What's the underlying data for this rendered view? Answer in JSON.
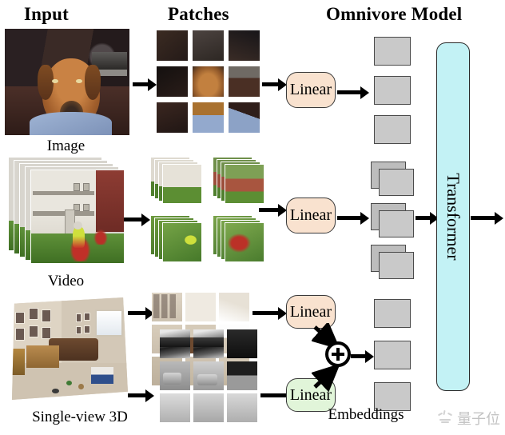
{
  "figure": {
    "title": "Omnivore Model architecture diagram",
    "headers": {
      "input": "Input",
      "patches": "Patches",
      "model": "Omnivore Model"
    },
    "row_labels": {
      "image": "Image",
      "video": "Video",
      "three_d": "Single-view 3D"
    },
    "embeddings_label": "Embeddings"
  },
  "blocks": {
    "linear_image": "Linear",
    "linear_video": "Linear",
    "linear_3d_rgb": "Linear",
    "linear_3d_depth": "Linear",
    "plus": "+",
    "transformer": "Transformer"
  },
  "colors": {
    "linear_rgb_fill": "#f9e2cf",
    "linear_depth_fill": "#e1f5d9",
    "transformer_fill": "#c3f2f5",
    "embedding_fill": "#c9c9c9",
    "embedding_border": "#4a4a4a",
    "arrow": "#000000",
    "background": "#ffffff",
    "watermark": "#c3c3c3"
  },
  "inputs": [
    {
      "id": "image",
      "label": "Image",
      "description": "Photo of a brown Rhodesian Ridgeback dog resting on a dark couch next to a person in blue jeans",
      "patch_grid": "3x3",
      "patch_type": "2D image patches",
      "linear_layers": 1,
      "embedding_tokens": 3,
      "embedding_style": "single"
    },
    {
      "id": "video",
      "label": "Video",
      "description": "Video clip of a child riding a dirt bike on grass in front of white and red buildings",
      "patch_grid": "2x2",
      "patch_type": "spatio-temporal tubes (stacked frames)",
      "linear_layers": 1,
      "embedding_tokens": 3,
      "embedding_style": "stacked"
    },
    {
      "id": "single_view_3d",
      "label": "Single-view 3D",
      "description": "RGB-D living room scene with brown couch, framed photos on the wall, table and window; split into RGB patches and depth patches",
      "patch_grid": "3x3 RGB + 3x3 depth",
      "patch_type": "RGB patches and depth patches",
      "linear_layers": 2,
      "combine_op": "+",
      "embedding_tokens": 3,
      "embedding_style": "single"
    }
  ],
  "watermark": {
    "text": "量子位"
  }
}
